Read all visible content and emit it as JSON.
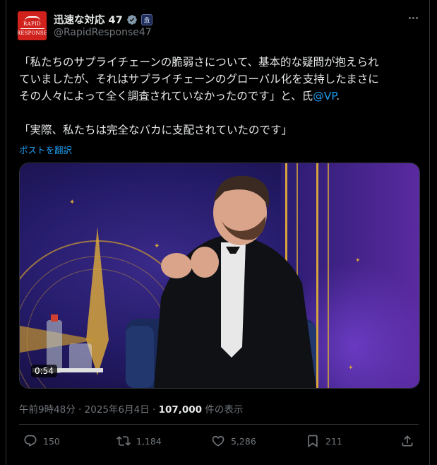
{
  "account": {
    "avatar_text_line1": "RAPID",
    "avatar_text_line2": "RESPONSE",
    "display_name": "迅速な対応 47",
    "handle": "@RapidResponse47",
    "verified_badge": "verified-check-icon",
    "affiliation_badge": "government-building-icon"
  },
  "tweet": {
    "line1": "「私たちのサプライチェーンの脆弱さについて、基本的な疑問が抱えられ",
    "line2": "ていましたが、それはサプライチェーンのグローバル化を支持したまさに",
    "line3_before": "その人々によって全く調査されていなかったのです」と、氏",
    "line3_mention": "@VP",
    "line3_after": ".",
    "line4": "「実際、私たちは完全なバカに支配されていたのです」",
    "translate_link": "ポストを翻訳"
  },
  "video": {
    "duration": "0:54"
  },
  "meta": {
    "time_date": "午前9時48分 · 2025年6月4日 · ",
    "views_count": "107,000",
    "views_label": " 件の表示"
  },
  "actions": {
    "replies": "150",
    "reposts": "1,184",
    "likes": "5,286",
    "bookmarks": "211"
  },
  "colors": {
    "background": "#000000",
    "text": "#e7e9ea",
    "secondary": "#71767b",
    "link": "#1d9bf0",
    "verified": "#829aab",
    "avatar_bg": "#d0211c"
  }
}
